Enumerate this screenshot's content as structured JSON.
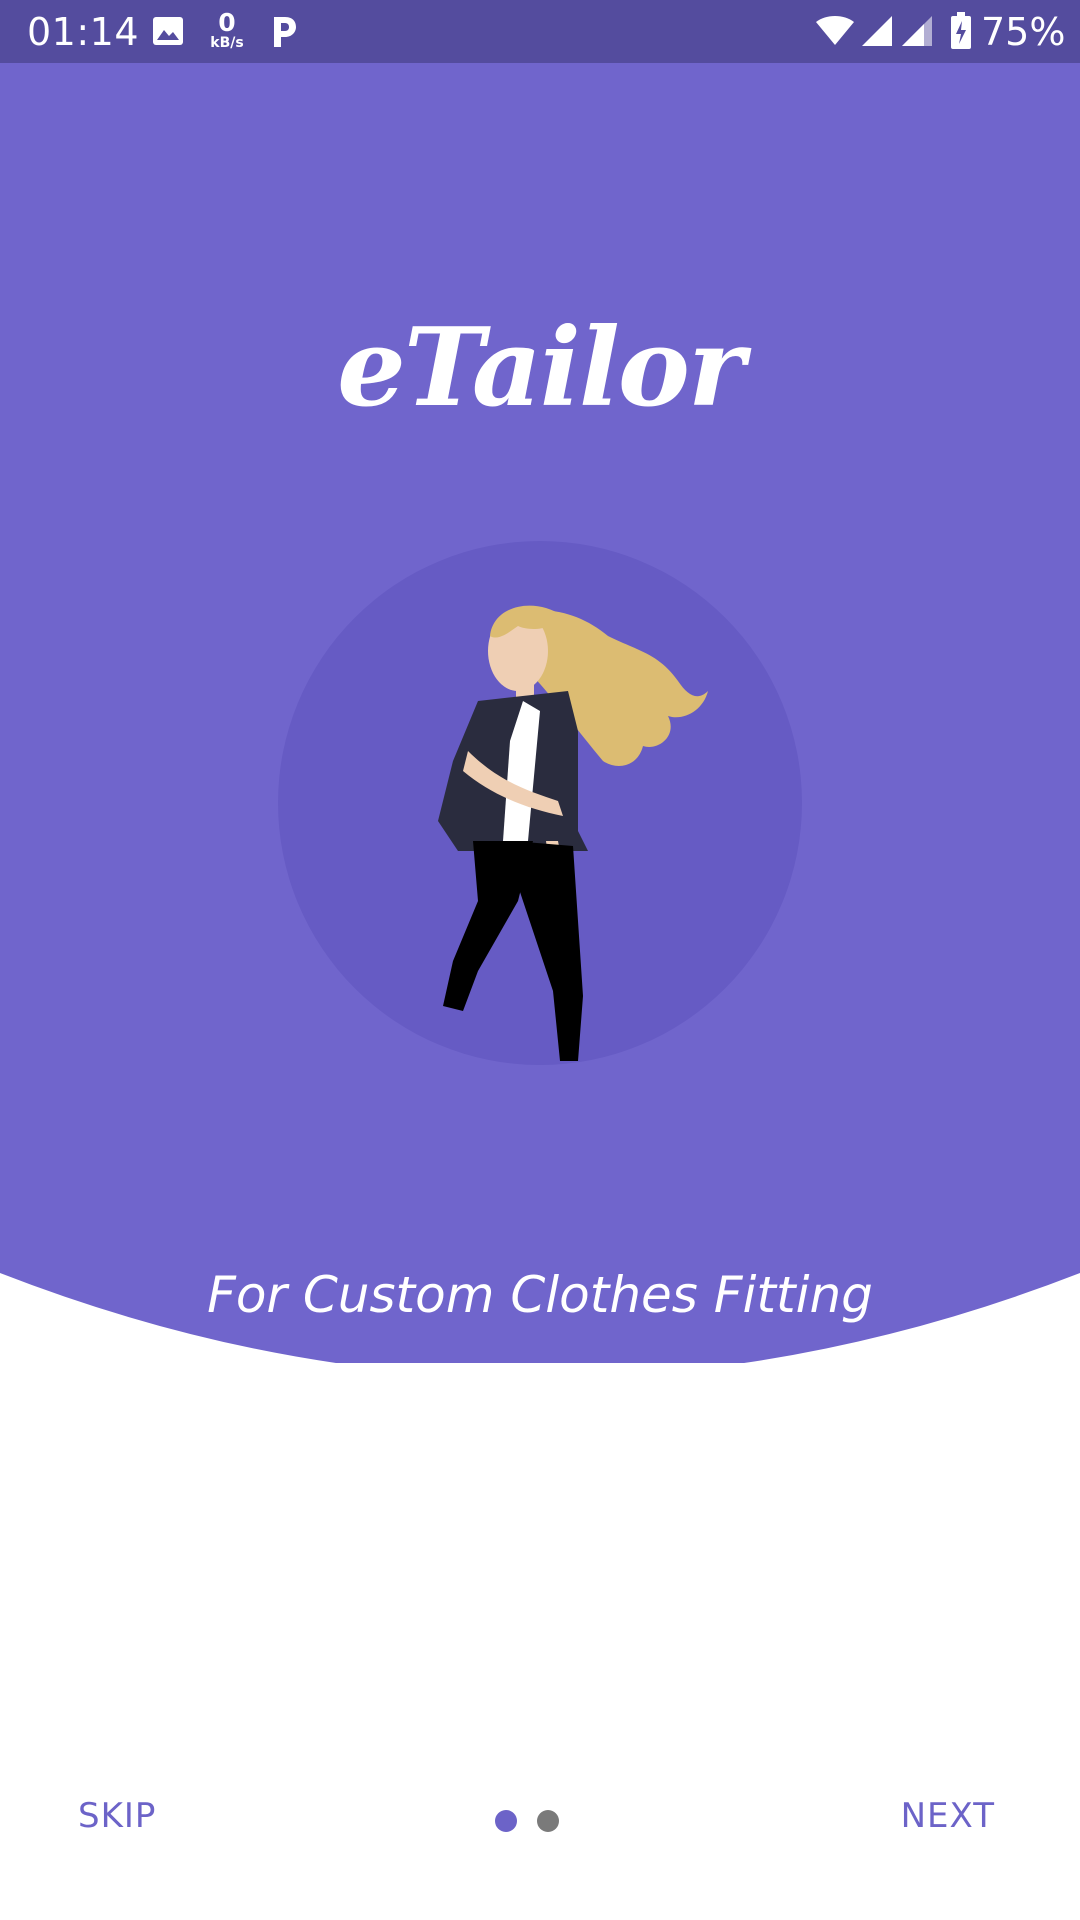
{
  "status_bar": {
    "time": "01:14",
    "net_speed_value": "0",
    "net_speed_unit": "kB/s",
    "battery_percent": "75%",
    "icons": [
      "image-icon",
      "parking-icon",
      "wifi-icon",
      "signal-icon",
      "signal-icon-2",
      "battery-charging-icon"
    ]
  },
  "onboarding": {
    "logo_text": "eTailor",
    "tagline": "For Custom Clothes Fitting",
    "page_indicator": {
      "current": 1,
      "total": 2
    },
    "skip_label": "SKIP",
    "next_label": "NEXT"
  },
  "colors": {
    "status_bar": "#544c9e",
    "primary": "#7065cc",
    "circle": "#665bc4",
    "accent_text": "#6c63c8",
    "inactive_dot": "#7a7a7a",
    "background": "#ffffff"
  }
}
